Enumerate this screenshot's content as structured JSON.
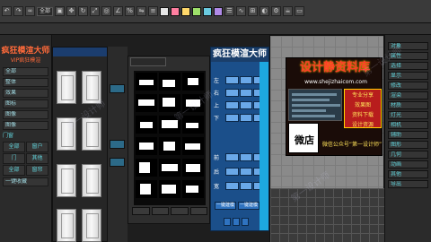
{
  "toolbar": {
    "select_value": "全部",
    "swatch_colors": [
      "#e6e6e6",
      "#ff7fa0",
      "#ffd86a",
      "#9ee06a",
      "#6acbe0",
      "#b08ae8"
    ]
  },
  "left_panel": {
    "title": "疯狂模渲大师",
    "subtitle": "VIP疯狂模渲",
    "items": [
      "全部",
      "整体",
      "效果",
      "图标",
      "图像",
      "图像",
      "门窗",
      "全部",
      "工具",
      "室内",
      "窗帘"
    ],
    "category": "门窗",
    "grid_labels": [
      "全部",
      "窗户",
      "门",
      "其他",
      "全部",
      "窗帘"
    ],
    "bottom_label": "一键收藏"
  },
  "main_panel": {
    "title": "疯狂模渲大师",
    "labels": [
      "左",
      "右",
      "上",
      "下",
      "前",
      "后",
      "宽"
    ],
    "bottom_buttons": [
      "一键建模",
      "一键建模"
    ]
  },
  "ad": {
    "title": "设计静资料库",
    "url": "www.shejizhaicom.com",
    "qr_text": "微店",
    "side_text": [
      "专业分享",
      "效果图",
      "资料下载",
      "设计资源"
    ],
    "wechat": "微信公众号“第一设计师”"
  },
  "right_panel": {
    "items": [
      "对象",
      "属性",
      "选择",
      "显示",
      "修改",
      "渲染",
      "材质",
      "灯光",
      "相机",
      "辅助",
      "图形",
      "几何",
      "动画",
      "其他",
      "导出"
    ]
  },
  "watermark": "第一设计师"
}
